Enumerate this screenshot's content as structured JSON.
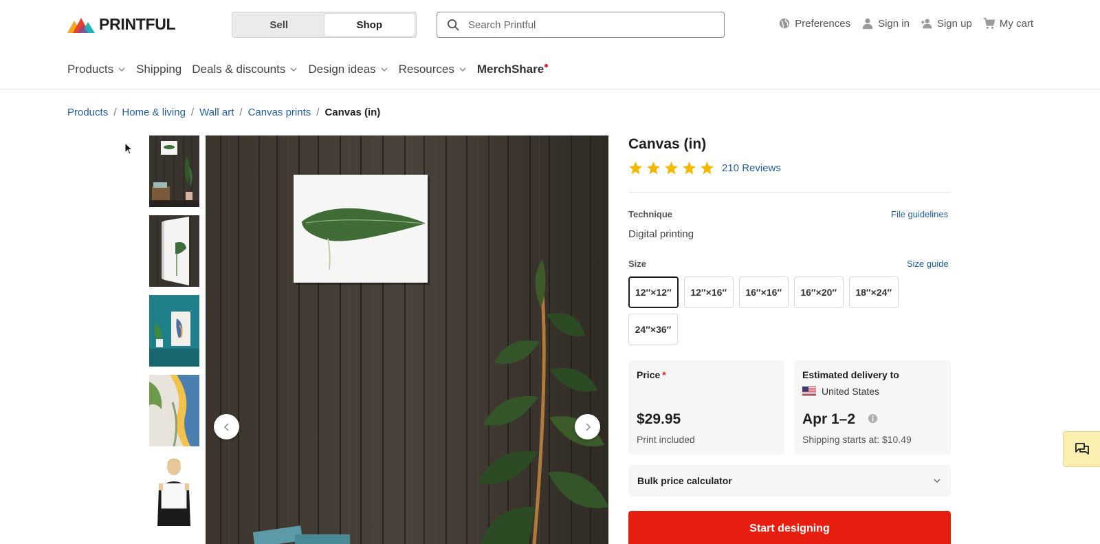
{
  "brand": {
    "name": "PRINTFUL"
  },
  "mode_switch": {
    "sell": "Sell",
    "shop": "Shop",
    "active": "Shop"
  },
  "search": {
    "placeholder": "Search Printful"
  },
  "top_links": {
    "preferences": "Preferences",
    "sign_in": "Sign in",
    "sign_up": "Sign up",
    "cart": "My cart"
  },
  "nav": {
    "products": "Products",
    "shipping": "Shipping",
    "deals": "Deals & discounts",
    "design_ideas": "Design ideas",
    "resources": "Resources",
    "merchshare": "MerchShare"
  },
  "breadcrumb": {
    "items": [
      "Products",
      "Home & living",
      "Wall art",
      "Canvas prints"
    ],
    "current": "Canvas (in)"
  },
  "gallery": {
    "thumbnails": [
      "canvas-on-wood-wall",
      "canvas-side-view",
      "bird-canvas-teal-wall",
      "abstract-canvas-closeup",
      "woman-holding-canvas"
    ],
    "active_index": 0
  },
  "product": {
    "title": "Canvas (in)",
    "rating": 5,
    "reviews": "210 Reviews",
    "technique_label": "Technique",
    "file_guidelines": "File guidelines",
    "technique": "Digital printing",
    "size_label": "Size",
    "size_guide": "Size guide",
    "sizes": [
      "12″×12″",
      "12″×16″",
      "16″×16″",
      "16″×20″",
      "18″×24″",
      "24″×36″"
    ],
    "selected_size": "12″×12″",
    "price_label": "Price",
    "price_required": "*",
    "price": "$29.95",
    "price_note": "Print included",
    "delivery_label": "Estimated delivery to",
    "delivery_country": "United States",
    "delivery_date": "Apr 1–2",
    "shipping_note": "Shipping starts at: $10.49",
    "bulk_calculator": "Bulk price calculator",
    "cta": "Start designing"
  },
  "colors": {
    "accent_red": "#e61e10",
    "link_blue": "#1f5fa8",
    "star_yellow": "#f5b800",
    "chat_bg": "#faeeb0"
  }
}
